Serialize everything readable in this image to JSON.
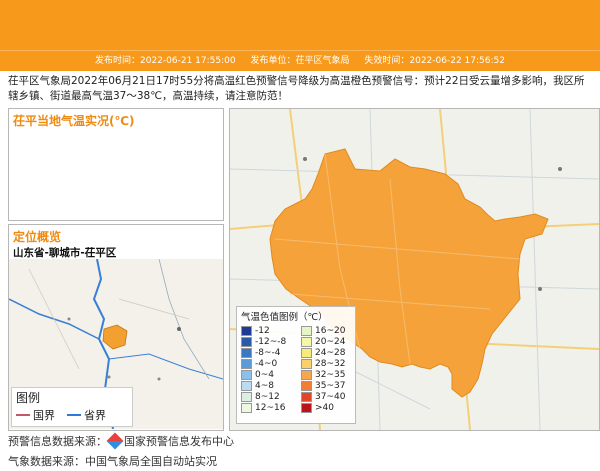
{
  "header": {
    "publish_time": "发布时间：2022-06-21 17:55:00",
    "publisher": "发布单位：茌平区气象局",
    "expire_time": "失效时间：2022-06-22 17:56:52"
  },
  "notice_text": "茌平区气象局2022年06月21日17时55分将高温红色预警信号降级为高温橙色预警信号：预计22日受云量增多影响，我区所辖乡镇、街道最高气温37～38℃，高温持续，请注意防范！",
  "temp_panel": {
    "title": "茌平当地气温实况(℃)"
  },
  "location_panel": {
    "title": "定位概览",
    "path": "山东省-聊城市-茌平区"
  },
  "mini_legend": {
    "title": "图例",
    "national": "国界",
    "provincial": "省界"
  },
  "color_legend": {
    "title": "气温色值图例（℃）",
    "items": [
      {
        "label": "-12",
        "color": "#1f3a93"
      },
      {
        "label": "16~20",
        "color": "#e6f5c8"
      },
      {
        "label": "-12~-8",
        "color": "#2a5aa8"
      },
      {
        "label": "20~24",
        "color": "#f5f7a8"
      },
      {
        "label": "-8~-4",
        "color": "#3b78c4"
      },
      {
        "label": "24~28",
        "color": "#f8eb7a"
      },
      {
        "label": "-4~0",
        "color": "#5b9bd8"
      },
      {
        "label": "28~32",
        "color": "#fbd06a"
      },
      {
        "label": "0~4",
        "color": "#8cc0ea"
      },
      {
        "label": "32~35",
        "color": "#f7a64e"
      },
      {
        "label": "4~8",
        "color": "#b9dcf2"
      },
      {
        "label": "35~37",
        "color": "#f07e34"
      },
      {
        "label": "8~12",
        "color": "#dcefe2"
      },
      {
        "label": "37~40",
        "color": "#e1452a"
      },
      {
        "label": "12~16",
        "color": "#eef8e0"
      },
      {
        "label": ">40",
        "color": "#b8141a"
      }
    ]
  },
  "sources": {
    "warning": "预警信息数据来源：",
    "warning_center": "国家预警信息发布中心",
    "weather": "气象数据来源：中国气象局全国自动站实况"
  },
  "region_fill": "#f6a23a"
}
